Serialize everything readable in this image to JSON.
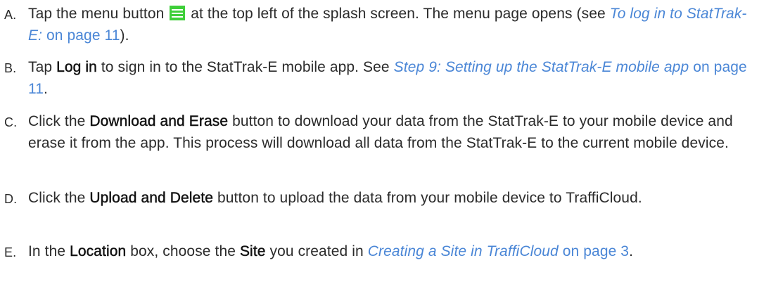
{
  "steps": [
    {
      "letter": "A.",
      "t1": "Tap the menu button",
      "t2": "at the top left of the splash screen. The menu page opens (see",
      "link_italic": "To log in to StatTrak-E:",
      "link_page": "on page 11",
      "t3": ")."
    },
    {
      "letter": "B.",
      "t1": "Tap",
      "bold1": "Log in",
      "t2": "to sign in to the StatTrak-E mobile app. See",
      "link_italic": "Step 9: Setting up the StatTrak-E mobile app",
      "link_page": "on page 11",
      "t3": "."
    },
    {
      "letter": "C.",
      "t1": "Click the",
      "bold1": "Download and Erase",
      "t2": "button to download your data from the StatTrak-E to your mobile device and erase it from the app. This process will download all data from the StatTrak-E to the current mobile device."
    },
    {
      "letter": "D.",
      "t1": "Click the",
      "bold1": "Upload and Delete",
      "t2": "button to upload the data from your mobile device to TraffiCloud."
    },
    {
      "letter": "E.",
      "t1": "In the",
      "bold1": "Location",
      "t2": "box, choose the",
      "bold2": "Site",
      "t3": "you created in",
      "link_italic": "Creating a Site in TraffiCloud",
      "link_page": "on page 3",
      "t4": "."
    }
  ],
  "icons": {
    "menu_button": {
      "name": "hamburger-menu-icon",
      "color": "#3fcf3a"
    }
  },
  "colors": {
    "text": "#2b2b2b",
    "link": "#4a86d6"
  }
}
